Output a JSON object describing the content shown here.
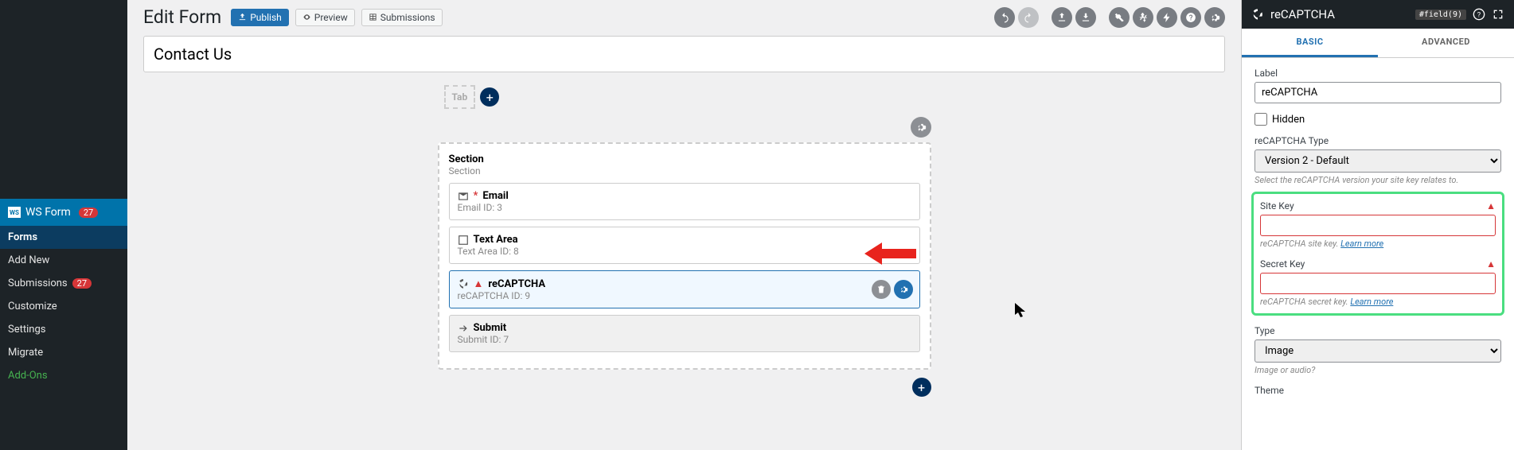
{
  "sidebar": {
    "main": "WS Form",
    "main_badge": "27",
    "items": [
      {
        "label": "Forms",
        "current": true
      },
      {
        "label": "Add New"
      },
      {
        "label": "Submissions",
        "badge": "27"
      },
      {
        "label": "Customize"
      },
      {
        "label": "Settings"
      },
      {
        "label": "Migrate"
      },
      {
        "label": "Add-Ons",
        "class": "addon"
      }
    ]
  },
  "header": {
    "title": "Edit Form",
    "publish": "Publish",
    "preview": "Preview",
    "submissions": "Submissions"
  },
  "formTitle": "Contact Us",
  "tab": {
    "drop": "Tab"
  },
  "section": {
    "title": "Section",
    "sub": "Section"
  },
  "fields": [
    {
      "icon": "envelope",
      "req": true,
      "label": "Email",
      "meta": "Email  ID: 3"
    },
    {
      "icon": "textarea",
      "req": false,
      "label": "Text Area",
      "meta": "Text Area  ID: 8"
    },
    {
      "icon": "recaptcha",
      "warn": true,
      "label": "reCAPTCHA",
      "meta": "reCAPTCHA  ID: 9",
      "active": true
    },
    {
      "icon": "arrow",
      "label": "Submit",
      "meta": "Submit  ID: 7",
      "submit": true
    }
  ],
  "panel": {
    "title": "reCAPTCHA",
    "fieldId": "#field(9)",
    "tabs": {
      "basic": "BASIC",
      "advanced": "ADVANCED"
    },
    "label": {
      "lbl": "Label",
      "val": "reCAPTCHA"
    },
    "hidden": "Hidden",
    "type": {
      "lbl": "reCAPTCHA Type",
      "val": "Version 2 - Default",
      "hint": "Select the reCAPTCHA version your site key relates to."
    },
    "siteKey": {
      "lbl": "Site Key",
      "hint": "reCAPTCHA site key. ",
      "link": "Learn more"
    },
    "secretKey": {
      "lbl": "Secret Key",
      "hint": "reCAPTCHA secret key. ",
      "link": "Learn more"
    },
    "rtype": {
      "lbl": "Type",
      "val": "Image",
      "hint": "Image or audio?"
    },
    "theme": {
      "lbl": "Theme"
    }
  }
}
